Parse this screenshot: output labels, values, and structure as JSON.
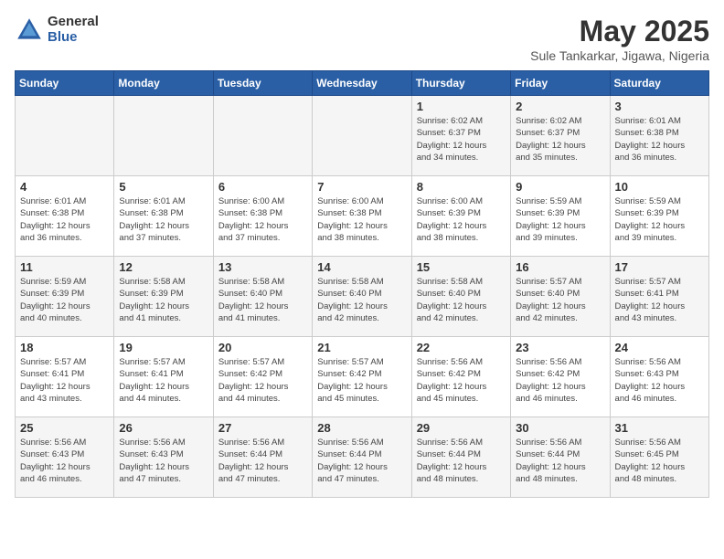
{
  "logo": {
    "general": "General",
    "blue": "Blue"
  },
  "title": "May 2025",
  "subtitle": "Sule Tankarkar, Jigawa, Nigeria",
  "days_of_week": [
    "Sunday",
    "Monday",
    "Tuesday",
    "Wednesday",
    "Thursday",
    "Friday",
    "Saturday"
  ],
  "weeks": [
    [
      {
        "day": "",
        "detail": ""
      },
      {
        "day": "",
        "detail": ""
      },
      {
        "day": "",
        "detail": ""
      },
      {
        "day": "",
        "detail": ""
      },
      {
        "day": "1",
        "detail": "Sunrise: 6:02 AM\nSunset: 6:37 PM\nDaylight: 12 hours\nand 34 minutes."
      },
      {
        "day": "2",
        "detail": "Sunrise: 6:02 AM\nSunset: 6:37 PM\nDaylight: 12 hours\nand 35 minutes."
      },
      {
        "day": "3",
        "detail": "Sunrise: 6:01 AM\nSunset: 6:38 PM\nDaylight: 12 hours\nand 36 minutes."
      }
    ],
    [
      {
        "day": "4",
        "detail": "Sunrise: 6:01 AM\nSunset: 6:38 PM\nDaylight: 12 hours\nand 36 minutes."
      },
      {
        "day": "5",
        "detail": "Sunrise: 6:01 AM\nSunset: 6:38 PM\nDaylight: 12 hours\nand 37 minutes."
      },
      {
        "day": "6",
        "detail": "Sunrise: 6:00 AM\nSunset: 6:38 PM\nDaylight: 12 hours\nand 37 minutes."
      },
      {
        "day": "7",
        "detail": "Sunrise: 6:00 AM\nSunset: 6:38 PM\nDaylight: 12 hours\nand 38 minutes."
      },
      {
        "day": "8",
        "detail": "Sunrise: 6:00 AM\nSunset: 6:39 PM\nDaylight: 12 hours\nand 38 minutes."
      },
      {
        "day": "9",
        "detail": "Sunrise: 5:59 AM\nSunset: 6:39 PM\nDaylight: 12 hours\nand 39 minutes."
      },
      {
        "day": "10",
        "detail": "Sunrise: 5:59 AM\nSunset: 6:39 PM\nDaylight: 12 hours\nand 39 minutes."
      }
    ],
    [
      {
        "day": "11",
        "detail": "Sunrise: 5:59 AM\nSunset: 6:39 PM\nDaylight: 12 hours\nand 40 minutes."
      },
      {
        "day": "12",
        "detail": "Sunrise: 5:58 AM\nSunset: 6:39 PM\nDaylight: 12 hours\nand 41 minutes."
      },
      {
        "day": "13",
        "detail": "Sunrise: 5:58 AM\nSunset: 6:40 PM\nDaylight: 12 hours\nand 41 minutes."
      },
      {
        "day": "14",
        "detail": "Sunrise: 5:58 AM\nSunset: 6:40 PM\nDaylight: 12 hours\nand 42 minutes."
      },
      {
        "day": "15",
        "detail": "Sunrise: 5:58 AM\nSunset: 6:40 PM\nDaylight: 12 hours\nand 42 minutes."
      },
      {
        "day": "16",
        "detail": "Sunrise: 5:57 AM\nSunset: 6:40 PM\nDaylight: 12 hours\nand 42 minutes."
      },
      {
        "day": "17",
        "detail": "Sunrise: 5:57 AM\nSunset: 6:41 PM\nDaylight: 12 hours\nand 43 minutes."
      }
    ],
    [
      {
        "day": "18",
        "detail": "Sunrise: 5:57 AM\nSunset: 6:41 PM\nDaylight: 12 hours\nand 43 minutes."
      },
      {
        "day": "19",
        "detail": "Sunrise: 5:57 AM\nSunset: 6:41 PM\nDaylight: 12 hours\nand 44 minutes."
      },
      {
        "day": "20",
        "detail": "Sunrise: 5:57 AM\nSunset: 6:42 PM\nDaylight: 12 hours\nand 44 minutes."
      },
      {
        "day": "21",
        "detail": "Sunrise: 5:57 AM\nSunset: 6:42 PM\nDaylight: 12 hours\nand 45 minutes."
      },
      {
        "day": "22",
        "detail": "Sunrise: 5:56 AM\nSunset: 6:42 PM\nDaylight: 12 hours\nand 45 minutes."
      },
      {
        "day": "23",
        "detail": "Sunrise: 5:56 AM\nSunset: 6:42 PM\nDaylight: 12 hours\nand 46 minutes."
      },
      {
        "day": "24",
        "detail": "Sunrise: 5:56 AM\nSunset: 6:43 PM\nDaylight: 12 hours\nand 46 minutes."
      }
    ],
    [
      {
        "day": "25",
        "detail": "Sunrise: 5:56 AM\nSunset: 6:43 PM\nDaylight: 12 hours\nand 46 minutes."
      },
      {
        "day": "26",
        "detail": "Sunrise: 5:56 AM\nSunset: 6:43 PM\nDaylight: 12 hours\nand 47 minutes."
      },
      {
        "day": "27",
        "detail": "Sunrise: 5:56 AM\nSunset: 6:44 PM\nDaylight: 12 hours\nand 47 minutes."
      },
      {
        "day": "28",
        "detail": "Sunrise: 5:56 AM\nSunset: 6:44 PM\nDaylight: 12 hours\nand 47 minutes."
      },
      {
        "day": "29",
        "detail": "Sunrise: 5:56 AM\nSunset: 6:44 PM\nDaylight: 12 hours\nand 48 minutes."
      },
      {
        "day": "30",
        "detail": "Sunrise: 5:56 AM\nSunset: 6:44 PM\nDaylight: 12 hours\nand 48 minutes."
      },
      {
        "day": "31",
        "detail": "Sunrise: 5:56 AM\nSunset: 6:45 PM\nDaylight: 12 hours\nand 48 minutes."
      }
    ]
  ]
}
